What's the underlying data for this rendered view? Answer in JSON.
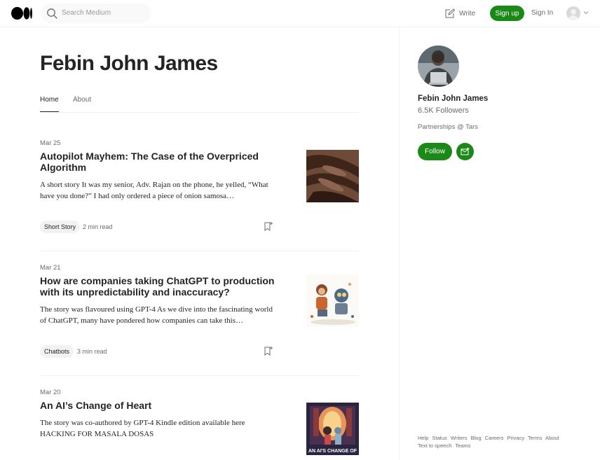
{
  "header": {
    "search_placeholder": "Search Medium",
    "write_label": "Write",
    "signup_label": "Sign up",
    "signin_label": "Sign In"
  },
  "profile": {
    "name": "Febin John James",
    "tabs": [
      "Home",
      "About"
    ],
    "followers": "6.5K Followers",
    "bio": "Partnerships @ Tars",
    "follow_label": "Follow"
  },
  "articles": [
    {
      "date": "Mar 25",
      "title": "Autopilot Mayhem: The Case of the Overpriced Algorithm",
      "excerpt": "A short story It was my senior, Adv. Rajan on the phone, he yelled, “What have you done?” I had only ordered a piece of onion samosa…",
      "tag": "Short Story",
      "read_time": "2 min read"
    },
    {
      "date": "Mar 21",
      "title": "How are companies taking ChatGPT to production with its unpredictability and inaccuracy?",
      "excerpt": "The story was flavoured using GPT-4 As we dive into the fascinating world of ChatGPT, many have pondered how companies can take this…",
      "tag": "Chatbots",
      "read_time": "3 min read"
    },
    {
      "date": "Mar 20",
      "title": "An AI’s Change of Heart",
      "excerpt": "The story was co-authored by GPT-4 Kindle edition available here HACKING FOR MASALA DOSAS",
      "thumb_text": "AN AI'S CHANGE OF"
    }
  ],
  "footer": {
    "links": [
      "Help",
      "Status",
      "Writers",
      "Blog",
      "Careers",
      "Privacy",
      "Terms",
      "About",
      "Text to speech",
      "Teams"
    ]
  },
  "colors": {
    "accent": "#1a8917",
    "text": "#242424",
    "muted": "#6b6b6b"
  }
}
